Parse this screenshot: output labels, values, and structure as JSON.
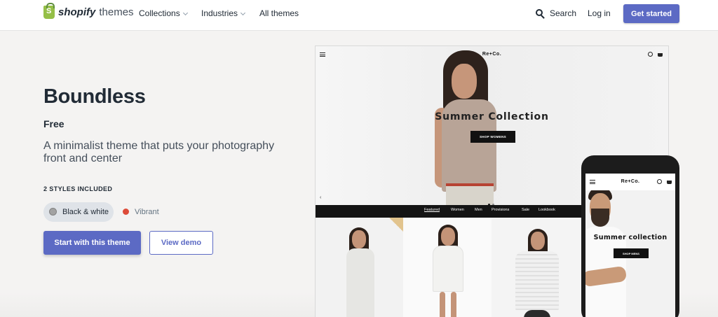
{
  "header": {
    "logo_word": "shopify",
    "logo_sub": "themes",
    "nav": {
      "collections": "Collections",
      "industries": "Industries",
      "all_themes": "All themes"
    },
    "search": "Search",
    "login": "Log in",
    "get_started": "Get started"
  },
  "theme": {
    "name": "Boundless",
    "price": "Free",
    "description": "A minimalist theme that puts your photography front and center",
    "styles_label": "2 STYLES INCLUDED",
    "styles": [
      {
        "name": "Black & white",
        "color": "#a2a2a2",
        "selected": true
      },
      {
        "name": "Vibrant",
        "color": "#dd4b39",
        "selected": false
      }
    ],
    "start_button": "Start with this theme",
    "demo_button": "View demo"
  },
  "preview": {
    "brand": "Re+Co.",
    "hero_title": "Summer Collection",
    "hero_button": "SHOP WOMENS",
    "menu": [
      "Featured",
      "Women",
      "Men",
      "Provisions",
      "Sale",
      "Lookbook"
    ],
    "mobile": {
      "brand": "Re+Co.",
      "hero_title": "Summer collection",
      "hero_button": "SHOP MENS"
    }
  },
  "colors": {
    "accent": "#5c6ac4",
    "text": "#212b36",
    "background": "#f4f3f2"
  }
}
